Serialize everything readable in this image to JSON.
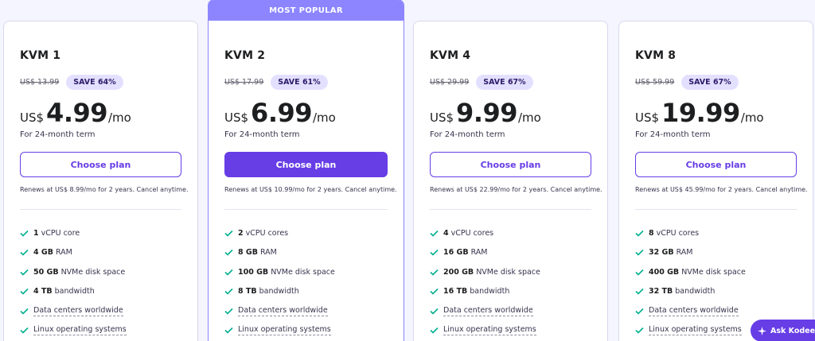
{
  "colors": {
    "accent": "#673de6",
    "banner": "#8c85ff",
    "check": "#00b090",
    "badge_bg": "#e3e0ff"
  },
  "plans": [
    {
      "name": "KVM 1",
      "old_price": "US$ 13.99",
      "save": "SAVE 64%",
      "currency": "US$",
      "price": "4.99",
      "per": "/mo",
      "term": "For 24-month term",
      "cta": "Choose plan",
      "renew": "Renews at US$ 8.99/mo for 2 years. Cancel anytime.",
      "features": [
        {
          "bold": "1",
          "text": "vCPU core"
        },
        {
          "bold": "4 GB",
          "text": "RAM"
        },
        {
          "bold": "50 GB",
          "text": "NVMe disk space"
        },
        {
          "bold": "4 TB",
          "text": "bandwidth"
        },
        {
          "bold": "",
          "text": "Data centers worldwide"
        },
        {
          "bold": "",
          "text": "Linux operating systems"
        }
      ]
    },
    {
      "name": "KVM 2",
      "banner": "MOST POPULAR",
      "old_price": "US$ 17.99",
      "save": "SAVE 61%",
      "currency": "US$",
      "price": "6.99",
      "per": "/mo",
      "term": "For 24-month term",
      "cta": "Choose plan",
      "renew": "Renews at US$ 10.99/mo for 2 years. Cancel anytime.",
      "features": [
        {
          "bold": "2",
          "text": "vCPU cores"
        },
        {
          "bold": "8 GB",
          "text": "RAM"
        },
        {
          "bold": "100 GB",
          "text": "NVMe disk space"
        },
        {
          "bold": "8 TB",
          "text": "bandwidth"
        },
        {
          "bold": "",
          "text": "Data centers worldwide"
        },
        {
          "bold": "",
          "text": "Linux operating systems"
        }
      ]
    },
    {
      "name": "KVM 4",
      "old_price": "US$ 29.99",
      "save": "SAVE 67%",
      "currency": "US$",
      "price": "9.99",
      "per": "/mo",
      "term": "For 24-month term",
      "cta": "Choose plan",
      "renew": "Renews at US$ 22.99/mo for 2 years. Cancel anytime.",
      "features": [
        {
          "bold": "4",
          "text": "vCPU cores"
        },
        {
          "bold": "16 GB",
          "text": "RAM"
        },
        {
          "bold": "200 GB",
          "text": "NVMe disk space"
        },
        {
          "bold": "16 TB",
          "text": "bandwidth"
        },
        {
          "bold": "",
          "text": "Data centers worldwide"
        },
        {
          "bold": "",
          "text": "Linux operating systems"
        }
      ]
    },
    {
      "name": "KVM 8",
      "old_price": "US$ 59.99",
      "save": "SAVE 67%",
      "currency": "US$",
      "price": "19.99",
      "per": "/mo",
      "term": "For 24-month term",
      "cta": "Choose plan",
      "renew": "Renews at US$ 45.99/mo for 2 years. Cancel anytime.",
      "features": [
        {
          "bold": "8",
          "text": "vCPU cores"
        },
        {
          "bold": "32 GB",
          "text": "RAM"
        },
        {
          "bold": "400 GB",
          "text": "NVMe disk space"
        },
        {
          "bold": "32 TB",
          "text": "bandwidth"
        },
        {
          "bold": "",
          "text": "Data centers worldwide"
        },
        {
          "bold": "",
          "text": "Linux operating systems"
        }
      ]
    }
  ],
  "assistant": {
    "label": "Ask Kodee",
    "icon": "sparkle-icon"
  }
}
